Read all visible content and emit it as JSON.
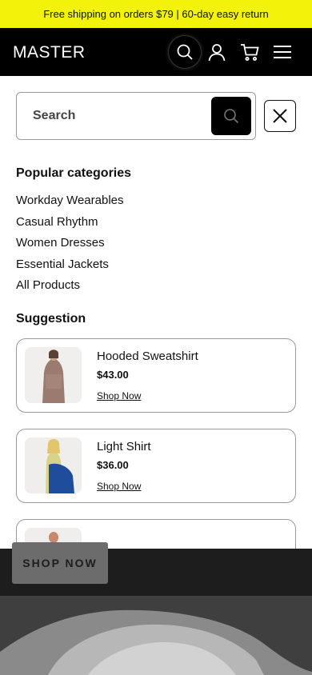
{
  "announcement": "Free shipping on orders $79 | 60-day easy return",
  "brand": "MASTER",
  "header_icons": [
    "search-icon",
    "account-icon",
    "cart-icon",
    "menu-icon"
  ],
  "search": {
    "placeholder": "Search",
    "value": ""
  },
  "popular": {
    "title": "Popular categories",
    "items": [
      "Workday Wearables",
      "Casual Rhythm",
      "Women Dresses",
      "Essential Jackets",
      "All Products"
    ]
  },
  "suggestion": {
    "title": "Suggestion",
    "products": [
      {
        "title": "Hooded Sweatshirt",
        "price": "$43.00",
        "link": "Shop Now"
      },
      {
        "title": "Light Shirt",
        "price": "$36.00",
        "link": "Shop Now"
      }
    ]
  },
  "hero": {
    "cta": "SHOP NOW"
  },
  "colors": {
    "announcement_bg": "#f2f20a",
    "header_bg": "#000000",
    "accent": "#000000"
  }
}
